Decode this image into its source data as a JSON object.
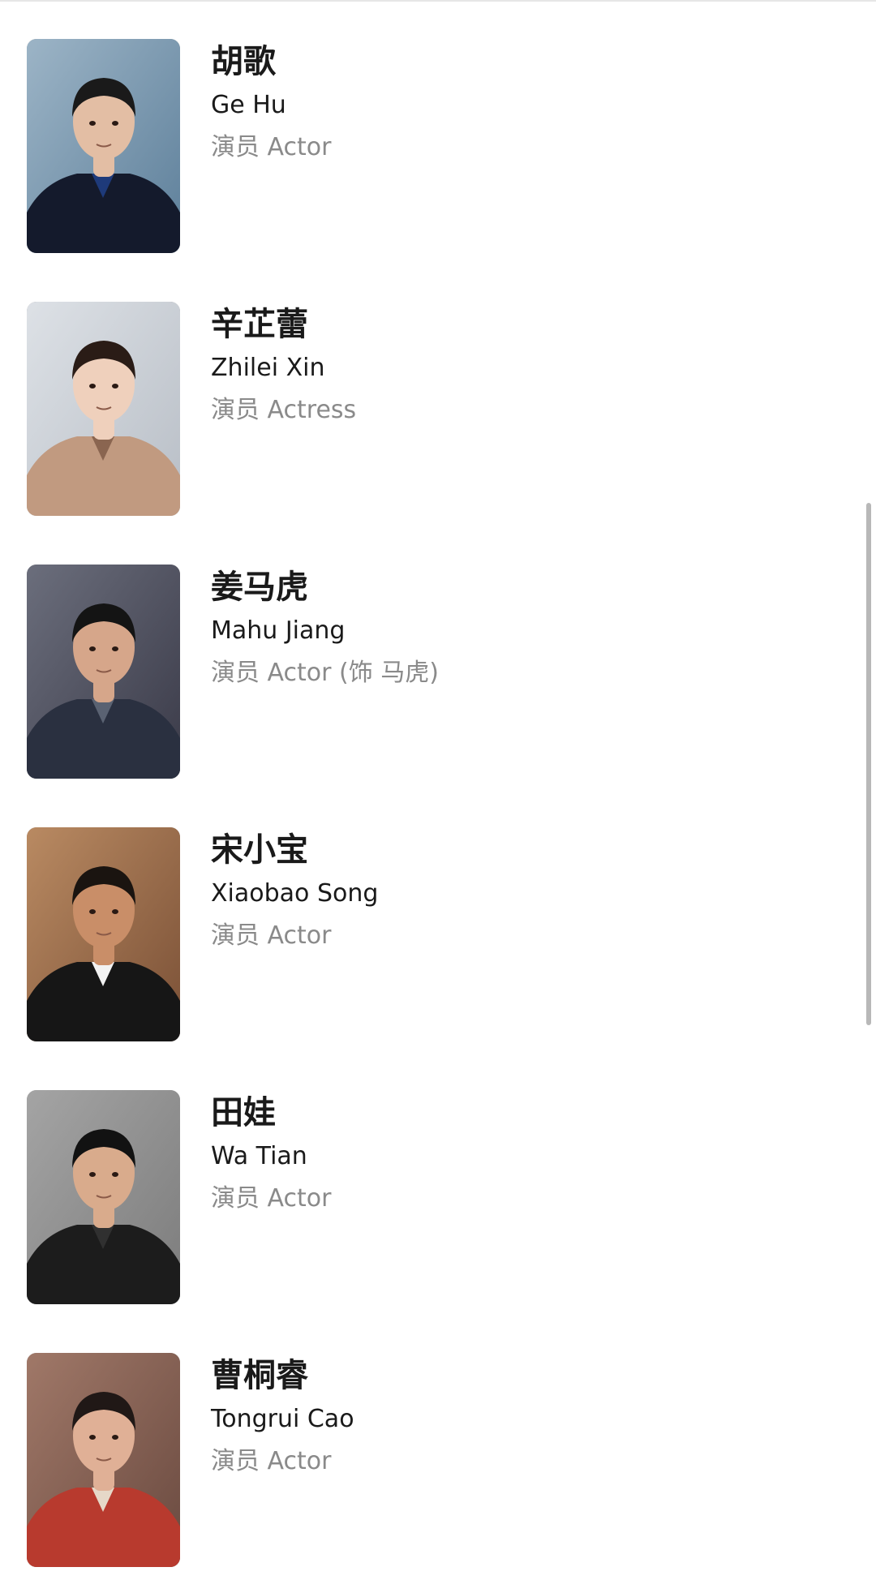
{
  "cast": [
    {
      "name_zh": "胡歌",
      "name_en": "Ge Hu",
      "role": "演员 Actor",
      "photo": {
        "bg": "#5d7f9a",
        "bg2": "#9cb4c6",
        "skin": "#e3bea4",
        "hair": "#1a1a1a",
        "clothes": "#141a2c",
        "accent": "#1e3a7a"
      }
    },
    {
      "name_zh": "辛芷蕾",
      "name_en": "Zhilei Xin",
      "role": "演员 Actress",
      "photo": {
        "bg": "#b8bec6",
        "bg2": "#dde1e6",
        "skin": "#efd0bc",
        "hair": "#2a1c16",
        "clothes": "#c19a80",
        "accent": "#8a6550"
      }
    },
    {
      "name_zh": "姜马虎",
      "name_en": "Mahu Jiang",
      "role": "演员 Actor (饰 马虎)",
      "photo": {
        "bg": "#3a3a48",
        "bg2": "#6b6e7c",
        "skin": "#d6a68a",
        "hair": "#141414",
        "clothes": "#2a3040",
        "accent": "#5a6272"
      }
    },
    {
      "name_zh": "宋小宝",
      "name_en": "Xiaobao Song",
      "role": "演员 Actor",
      "photo": {
        "bg": "#7a5036",
        "bg2": "#b98a62",
        "skin": "#c98e68",
        "hair": "#1a1410",
        "clothes": "#161616",
        "accent": "#f2f2f2"
      }
    },
    {
      "name_zh": "田娃",
      "name_en": "Wa Tian",
      "role": "演员 Actor",
      "photo": {
        "bg": "#7c7c7c",
        "bg2": "#a4a4a4",
        "skin": "#d9ab8c",
        "hair": "#121212",
        "clothes": "#1c1c1c",
        "accent": "#303030"
      }
    },
    {
      "name_zh": "曹桐睿",
      "name_en": "Tongrui Cao",
      "role": "演员 Actor",
      "photo": {
        "bg": "#6a4a40",
        "bg2": "#a07868",
        "skin": "#e0b096",
        "hair": "#201816",
        "clothes": "#b83a2e",
        "accent": "#e6d8c8"
      }
    }
  ]
}
